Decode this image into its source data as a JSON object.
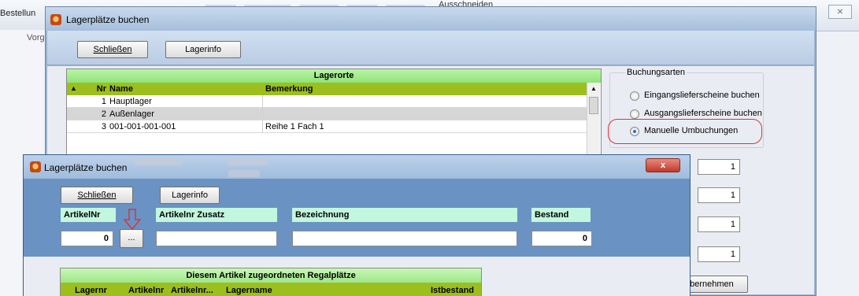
{
  "background_app": {
    "tab_bestellung": "Bestellun",
    "tab_vorgang": "Vorga",
    "ribbon_ausschneiden": "Ausschneiden",
    "close_glyph": "⨯"
  },
  "dialog_main": {
    "title": "Lagerplätze buchen",
    "toolbar": {
      "schliessen": "Schließen",
      "lagerinfo": "Lagerinfo"
    },
    "lagerorte": {
      "title": "Lagerorte",
      "columns": {
        "sort": "▲",
        "nr": "Nr",
        "name": "Name",
        "bemerkung": "Bemerkung"
      },
      "rows": [
        {
          "nr": "1",
          "name": "Hauptlager",
          "bemerkung": ""
        },
        {
          "nr": "2",
          "name": "Außenlager",
          "bemerkung": ""
        },
        {
          "nr": "3",
          "name": "001-001-001-001",
          "bemerkung": "Reihe 1 Fach 1"
        }
      ],
      "scroll_up": "▲"
    },
    "buchungsarten": {
      "legend": "Buchungsarten",
      "options": [
        {
          "label": "Eingangslieferscheine buchen",
          "selected": false
        },
        {
          "label": "Ausgangslieferscheine buchen",
          "selected": false
        },
        {
          "label": "Manuelle Umbuchungen",
          "selected": true
        }
      ]
    },
    "quantities": [
      "1",
      "1",
      "1",
      "1"
    ],
    "ubernehmen": "Übernehmen"
  },
  "dialog_second": {
    "title": "Lagerplätze buchen",
    "close_glyph": "x",
    "toolbar": {
      "schliessen": "Schließen",
      "lagerinfo": "Lagerinfo"
    },
    "fields": {
      "artikelnr_label": "ArtikelNr",
      "artikelnr_value": "0",
      "lookup_button": "...",
      "zusatz_label": "Artikelnr Zusatz",
      "zusatz_value": "",
      "bezeichnung_label": "Bezeichnung",
      "bezeichnung_value": "",
      "bestand_label": "Bestand",
      "bestand_value": "0"
    },
    "regalplaetze": {
      "title": "Diesem Artikel zugeordneten Regalplätze",
      "columns": [
        "Lagernr",
        "Artikelnr",
        "Artikelnr...",
        "Lagername",
        "Istbestand"
      ]
    }
  },
  "colors": {
    "grid_header_green": "#9cbf1e",
    "grid_title_green": "#8fe37a",
    "label_mint": "#c3f6de",
    "annotation_red": "#d4363a",
    "dialog_blue": "#6a93c3"
  }
}
